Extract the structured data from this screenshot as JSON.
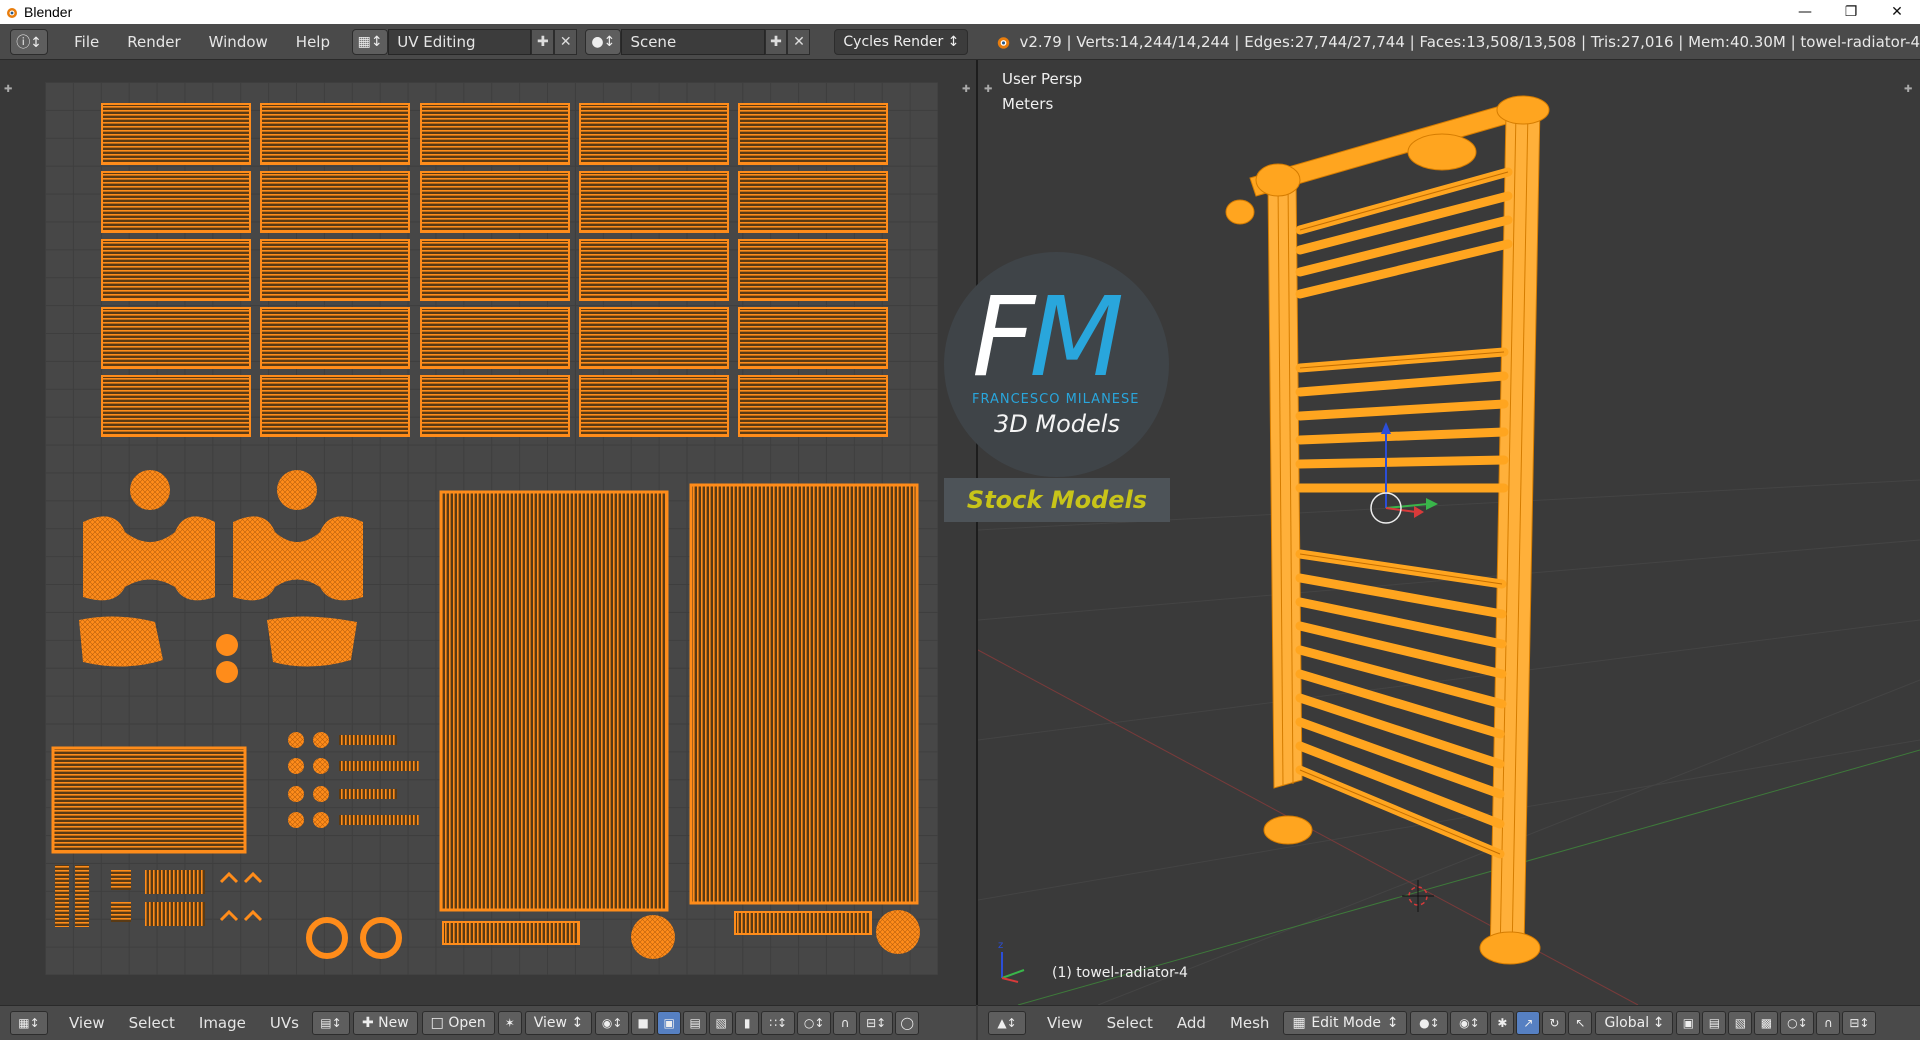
{
  "window": {
    "title": "Blender"
  },
  "top_menu": {
    "items": [
      "File",
      "Render",
      "Window",
      "Help"
    ]
  },
  "layout": {
    "screen": "UV Editing",
    "scene": "Scene",
    "engine": "Cycles Render"
  },
  "stats": "v2.79 | Verts:14,244/14,244 | Edges:27,744/27,744 | Faces:13,508/13,508 | Tris:27,016 | Mem:40.30M | towel-radiator-4",
  "viewport": {
    "view": "User Persp",
    "units": "Meters",
    "object": "(1) towel-radiator-4"
  },
  "uv_header": {
    "menus": [
      "View",
      "Select",
      "Image",
      "UVs"
    ],
    "new": "New",
    "open": "Open",
    "view": "View"
  },
  "vp_header": {
    "menus": [
      "View",
      "Select",
      "Add",
      "Mesh"
    ],
    "mode": "Edit Mode",
    "orientation": "Global"
  },
  "watermark": {
    "logo": "FM",
    "name": "FRANCESCO MILANESE",
    "tagline": "3D Models",
    "stock": "Stock Models"
  },
  "colors": {
    "accent": "#ff8c1a",
    "mesh": "#ffa51f",
    "selected": "#5680c2"
  }
}
